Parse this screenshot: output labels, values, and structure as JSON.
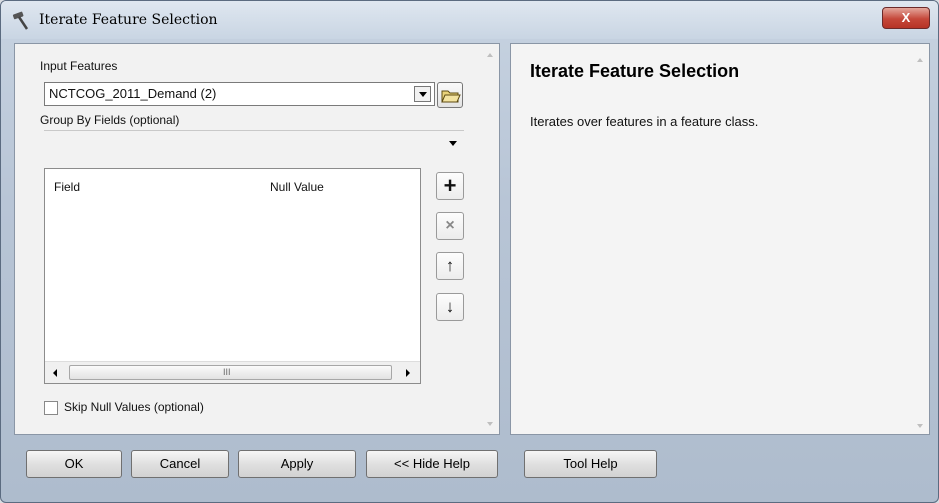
{
  "window": {
    "title": "Iterate Feature Selection",
    "close_label": "X"
  },
  "form": {
    "input_features_label": "Input Features",
    "input_features_value": "NCTCOG_2011_Demand (2)",
    "group_by_label": "Group By Fields (optional)",
    "grid": {
      "columns": [
        "Field",
        "Null Value"
      ],
      "scroll_grip": "III"
    },
    "side_buttons": {
      "add": "+",
      "remove": "×",
      "up": "↑",
      "down": "↓"
    },
    "skip_null_label": "Skip Null Values (optional)",
    "skip_null_checked": false
  },
  "help": {
    "title": "Iterate Feature Selection",
    "text": "Iterates over features in a feature class."
  },
  "buttons": {
    "ok": "OK",
    "cancel": "Cancel",
    "apply": "Apply",
    "hide_help": "<< Hide Help",
    "tool_help": "Tool Help"
  },
  "icons": {
    "title": "hammer-icon",
    "browse": "open-folder-icon",
    "add": "plus-icon",
    "remove": "x-icon",
    "up": "arrow-up-icon",
    "down": "arrow-down-icon"
  }
}
